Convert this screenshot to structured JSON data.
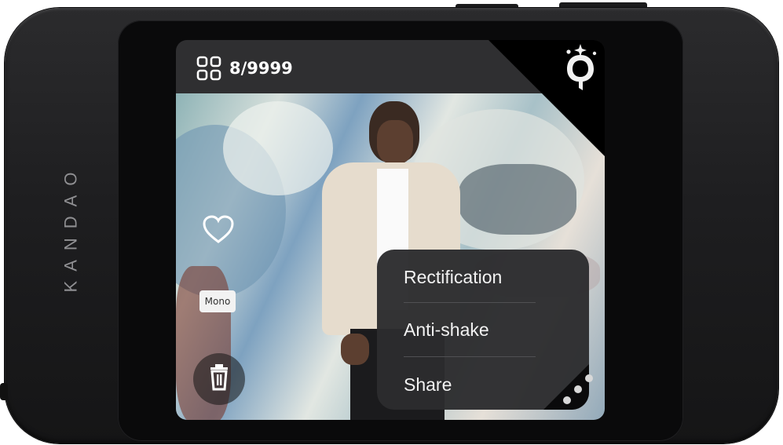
{
  "device": {
    "brand": "KANDAO"
  },
  "gallery": {
    "counter": "8/9999",
    "grid_icon": "grid-icon",
    "logo_icon": "q-logo-icon"
  },
  "photo": {
    "favorite_icon": "heart-icon",
    "filter_badge": "Mono",
    "delete_icon": "trash-icon"
  },
  "menu": {
    "items": [
      {
        "label": "Rectification"
      },
      {
        "label": "Anti-shake"
      },
      {
        "label": "Share"
      }
    ],
    "more_icon": "more-dots-icon"
  },
  "colors": {
    "device_body": "#1e1e20",
    "topbar": "#2f2f31",
    "menu_bg": "#2c2c2e",
    "text": "#ffffff"
  }
}
